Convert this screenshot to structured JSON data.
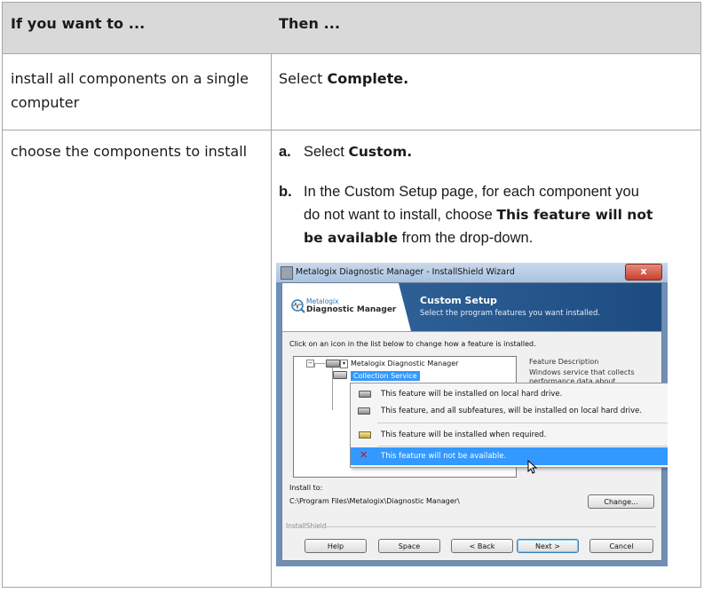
{
  "table": {
    "header": {
      "left": "If you want to ...",
      "right": "Then ..."
    },
    "row1": {
      "left_line1": "install all components on a single",
      "left_line2": "computer",
      "right_prefix": "Select ",
      "right_bold": "Complete."
    },
    "row2": {
      "left": "choose the components to install",
      "step_a": {
        "label": "a.",
        "prefix": "Select ",
        "bold": "Custom."
      },
      "step_b": {
        "label": "b.",
        "line1": "In the Custom Setup page, for each component you",
        "line2_prefix": "do not want to install, choose ",
        "line2_bold": "This feature will not",
        "line3_bold": "be available",
        "line3_suffix": " from the drop-down."
      }
    }
  },
  "wizard": {
    "title": "Metalogix Diagnostic Manager - InstallShield Wizard",
    "close_glyph": "x",
    "logo_small": "Metalogix",
    "logo_big": "Diagnostic Manager",
    "heading": "Custom Setup",
    "subheading": "Select the program features you want installed.",
    "instruction": "Click on an icon in the list below to change how a feature is installed.",
    "tree": {
      "root": "Metalogix Diagnostic Manager",
      "selected": "Collection Service"
    },
    "feature_description": {
      "heading": "Feature Description",
      "text": "Windows service that collects performance data about"
    },
    "menu": [
      "This feature will be installed on local hard drive.",
      "This feature, and all subfeatures, will be installed on local hard drive.",
      "This feature will be installed when required.",
      "This feature will not be available."
    ],
    "install_to_label": "Install to:",
    "install_to_path": "C:\\Program Files\\Metalogix\\Diagnostic Manager\\",
    "change_button": "Change...",
    "footer_label": "InstallShield",
    "buttons": {
      "help": "Help",
      "space": "Space",
      "back": "< Back",
      "next": "Next >",
      "cancel": "Cancel"
    }
  }
}
